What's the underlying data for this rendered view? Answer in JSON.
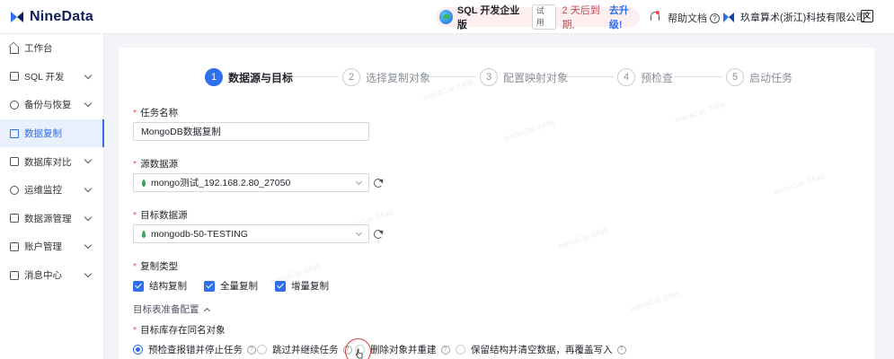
{
  "app": {
    "brand": "NineData"
  },
  "header": {
    "edition_name": "SQL 开发企业版",
    "trial_badge": "试用",
    "expire_text": "2 天后到期,",
    "upgrade_link": "去升级!",
    "help_docs": "帮助文档",
    "company": "玖章算术(浙江)科技有限公司",
    "lang_icon": "language-icon"
  },
  "sidebar": {
    "items": [
      {
        "label": "工作台",
        "icon": "home-icon",
        "expandable": false,
        "active": false
      },
      {
        "label": "SQL 开发",
        "icon": "terminal-icon",
        "expandable": true,
        "active": false
      },
      {
        "label": "备份与恢复",
        "icon": "backup-icon",
        "expandable": true,
        "active": false
      },
      {
        "label": "数据复制",
        "icon": "replication-icon",
        "expandable": false,
        "active": true
      },
      {
        "label": "数据库对比",
        "icon": "compare-icon",
        "expandable": true,
        "active": false
      },
      {
        "label": "运维监控",
        "icon": "monitor-icon",
        "expandable": true,
        "active": false
      },
      {
        "label": "数据源管理",
        "icon": "datasource-icon",
        "expandable": true,
        "active": false
      },
      {
        "label": "账户管理",
        "icon": "account-icon",
        "expandable": true,
        "active": false
      },
      {
        "label": "消息中心",
        "icon": "message-icon",
        "expandable": true,
        "active": false
      }
    ]
  },
  "steps": [
    {
      "num": "1",
      "label": "数据源与目标",
      "active": true
    },
    {
      "num": "2",
      "label": "选择复制对象",
      "active": false
    },
    {
      "num": "3",
      "label": "配置映射对象",
      "active": false
    },
    {
      "num": "4",
      "label": "预检查",
      "active": false
    },
    {
      "num": "5",
      "label": "启动任务",
      "active": false
    }
  ],
  "form": {
    "task_name": {
      "label": "任务名称",
      "value": "MongoDB数据复制"
    },
    "source": {
      "label": "源数据源",
      "value": "mongo测试_192.168.2.80_27050"
    },
    "target": {
      "label": "目标数据源",
      "value": "mongodb-50-TESTING"
    },
    "replication_type": {
      "label": "复制类型",
      "options": [
        {
          "label": "结构复制",
          "checked": true
        },
        {
          "label": "全量复制",
          "checked": true
        },
        {
          "label": "增量复制",
          "checked": true
        }
      ]
    },
    "target_prep": {
      "label": "目标表准备配置"
    },
    "same_name": {
      "label": "目标库存在同名对象",
      "options": [
        {
          "label": "预检查报错并停止任务",
          "selected": true
        },
        {
          "label": "跳过并继续任务",
          "selected": false
        },
        {
          "label": "删除对象并重建",
          "selected": false
        },
        {
          "label": "保留结构并清空数据，再覆盖写入",
          "selected": false
        }
      ]
    }
  },
  "colors": {
    "accent": "#2f6fed",
    "required": "#f54a45",
    "expire": "#c04a56"
  }
}
